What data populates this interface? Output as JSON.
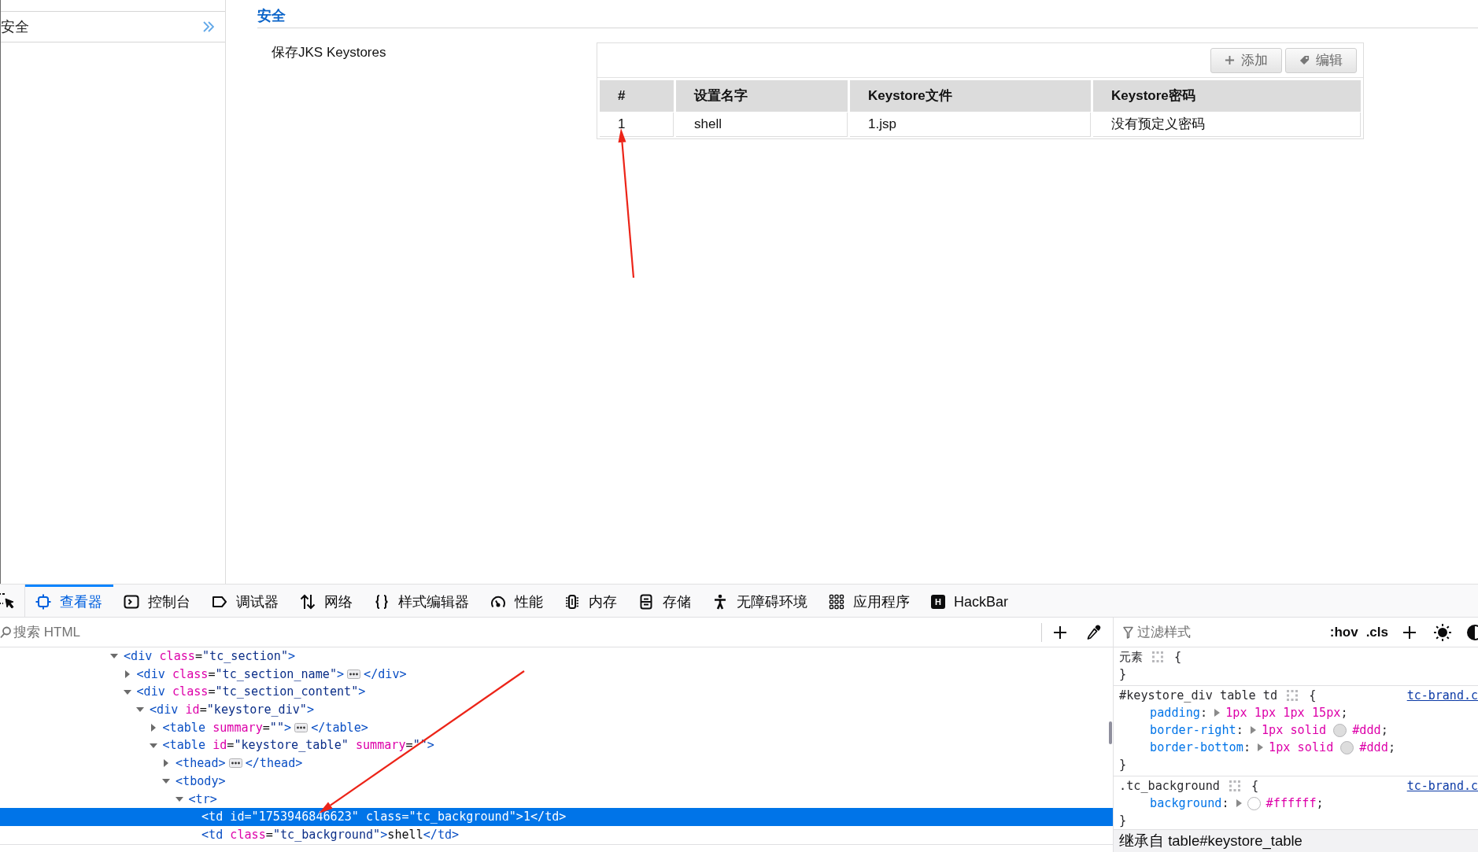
{
  "sidebar": {
    "items": [
      {
        "label": "安全",
        "selected": true
      }
    ]
  },
  "section": {
    "title": "安全",
    "setting_label": "保存JKS Keystores",
    "keystore_table": {
      "buttons": [
        {
          "label": "添加"
        },
        {
          "label": "编辑"
        }
      ],
      "columns": [
        "#",
        "设置名字",
        "Keystore文件",
        "Keystore密码"
      ],
      "rows": [
        [
          "1",
          "shell",
          "1.jsp",
          "没有预定义密码"
        ]
      ]
    }
  },
  "devtools": {
    "tabs": [
      {
        "label": "查看器",
        "selected": true
      },
      {
        "label": "控制台",
        "selected": false
      },
      {
        "label": "调试器",
        "selected": false
      },
      {
        "label": "网络",
        "selected": false
      },
      {
        "label": "样式编辑器",
        "selected": false
      },
      {
        "label": "性能",
        "selected": false
      },
      {
        "label": "内存",
        "selected": false
      },
      {
        "label": "存储",
        "selected": false
      },
      {
        "label": "无障碍环境",
        "selected": false
      },
      {
        "label": "应用程序",
        "selected": false
      },
      {
        "label": "HackBar",
        "selected": false,
        "badge": "H"
      }
    ],
    "inspector": {
      "search": {
        "placeholder": "搜索 HTML"
      },
      "tree": [
        {
          "markup": "<div class=\"tc_section\">",
          "expanded": true,
          "selected": false,
          "children": [
            {
              "markup": "<div class=\"tc_section_name\">",
              "expanded": false,
              "selected": false,
              "closing": "</div>"
            },
            {
              "markup": "<div class=\"tc_section_content\">",
              "expanded": true,
              "selected": false,
              "children": [
                {
                  "markup": "<div id=\"keystore_div\">",
                  "expanded": true,
                  "selected": false,
                  "children": [
                    {
                      "markup": "<table summary=\"\">",
                      "expanded": false,
                      "selected": false,
                      "closing": "</table>"
                    },
                    {
                      "markup": "<table id=\"keystore_table\" summary=\"\">",
                      "expanded": true,
                      "selected": false,
                      "children": [
                        {
                          "markup": "<thead>",
                          "expanded": false,
                          "selected": false,
                          "closing": "</thead>"
                        },
                        {
                          "markup": "<tbody>",
                          "expanded": true,
                          "selected": false,
                          "children": [
                            {
                              "markup": "<tr>",
                              "expanded": true,
                              "selected": false,
                              "children": [
                                {
                                  "markup": "<td id=\"1753946846623\" class=\"tc_background\">1</td>",
                                  "selected": true
                                },
                                {
                                  "markup": "<td class=\"tc_background\">shell</td>",
                                  "selected": false
                                }
                              ]
                            }
                          ]
                        }
                      ]
                    }
                  ]
                }
              ]
            }
          ]
        }
      ]
    },
    "rules_panel": {
      "filter": {
        "placeholder": "过滤样式"
      },
      "toggles": [
        ":hov",
        ".cls"
      ],
      "rules": [
        {
          "selector": "元素",
          "open_brace": "{",
          "close_brace": "}"
        },
        {
          "selector": "#keystore_div table td",
          "open_brace": "{",
          "source": "tc-brand.c",
          "declarations": [
            {
              "property": "padding:",
              "value": "1px 1px 1px 15px;"
            },
            {
              "property": "border-right:",
              "value_lead": "1px solid",
              "color": "#dddddd",
              "value": "#ddd;"
            },
            {
              "property": "border-bottom:",
              "value_lead": "1px solid",
              "color": "#dddddd",
              "value": "#ddd;"
            }
          ],
          "close_brace": "}"
        },
        {
          "selector": ".tc_background",
          "open_brace": "{",
          "source": "tc-brand.c",
          "declarations": [
            {
              "property": "background:",
              "color": "#ffffff",
              "value": "#ffffff;"
            }
          ],
          "close_brace": "}"
        }
      ],
      "inherited_header": "继承自 table#keystore_table"
    }
  }
}
